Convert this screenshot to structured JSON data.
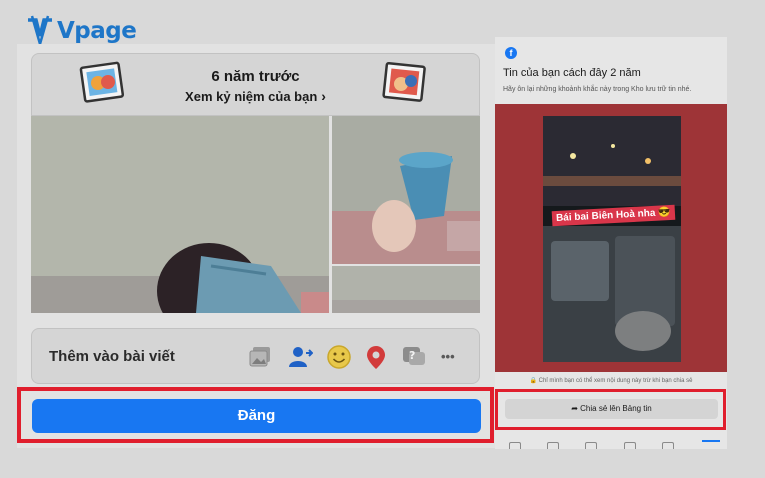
{
  "brand": {
    "name": "Vpage",
    "color": "#1e76c8"
  },
  "memory": {
    "title": "6 năm trước",
    "subtitle": "Xem kỷ niệm của bạn",
    "chevron": "›"
  },
  "composer": {
    "add_to_post_label": "Thêm vào bài viết",
    "icons": [
      "photo-icon",
      "tag-people-icon",
      "emoji-icon",
      "location-icon",
      "question-icon",
      "more-icon"
    ],
    "more_glyph": "•••",
    "post_button_label": "Đăng",
    "accent": "#1877f2"
  },
  "story": {
    "fb_glyph": "f",
    "title": "Tin của bạn cách đây 2 năm",
    "subtitle": "Hãy ôn lại những khoảnh khắc này trong Kho lưu trữ tin nhé.",
    "caption": "Bái bai Biên Hoà nha 😎",
    "privacy_note": "🔒 Chỉ mình bạn có thể xem nội dung này trừ khi bạn chia sẻ",
    "share_button_label": "Chia sẻ lên Bảng tin",
    "background": "#9e3437"
  },
  "highlight_color": "#e01e2d"
}
